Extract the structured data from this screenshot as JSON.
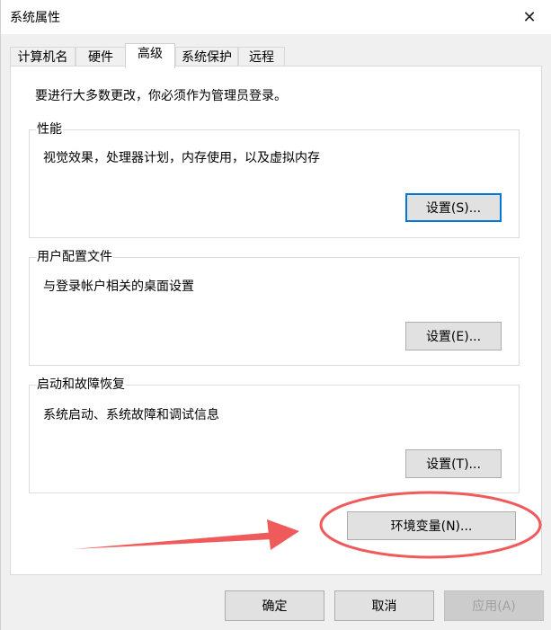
{
  "window": {
    "title": "系统属性",
    "close_glyph": "✕"
  },
  "tabs": [
    {
      "label": "计算机名"
    },
    {
      "label": "硬件"
    },
    {
      "label": "高级",
      "active": true
    },
    {
      "label": "系统保护"
    },
    {
      "label": "远程"
    }
  ],
  "advanced": {
    "admin_note": "要进行大多数更改，你必须作为管理员登录。",
    "performance": {
      "title": "性能",
      "description": "视觉效果，处理器计划，内存使用，以及虚拟内存",
      "button": "设置(S)..."
    },
    "user_profiles": {
      "title": "用户配置文件",
      "description": "与登录帐户相关的桌面设置",
      "button": "设置(E)..."
    },
    "startup_recovery": {
      "title": "启动和故障恢复",
      "description": "系统启动、系统故障和调试信息",
      "button": "设置(T)..."
    },
    "env_button": "环境变量(N)..."
  },
  "footer": {
    "ok": "确定",
    "cancel": "取消",
    "apply": "应用(A)"
  },
  "annotation": {
    "color": "#ef5b5b",
    "arrow_icon": "arrow-right-icon",
    "highlight_icon": "ellipse-highlight"
  }
}
